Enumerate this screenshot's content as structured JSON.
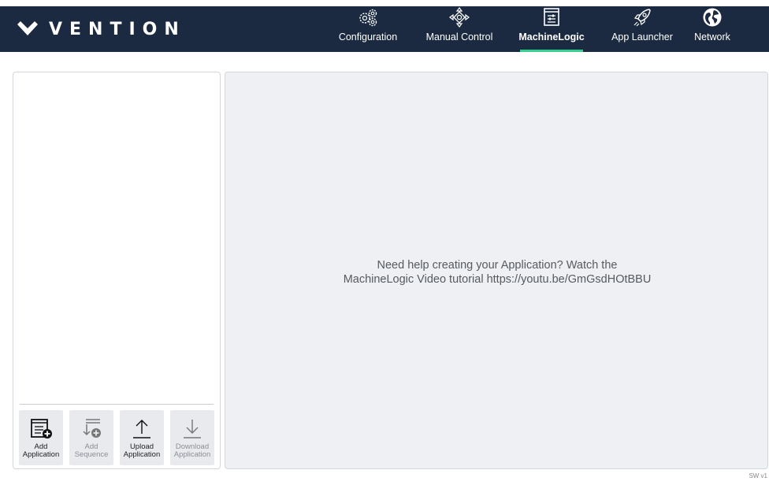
{
  "brand": {
    "name": "VENTION"
  },
  "nav": {
    "items": [
      {
        "label": "Configuration",
        "icon": "gears-icon"
      },
      {
        "label": "Manual Control",
        "icon": "joystick-icon"
      },
      {
        "label": "MachineLogic",
        "icon": "logic-icon",
        "active": true
      },
      {
        "label": "App Launcher",
        "icon": "rocket-icon"
      },
      {
        "label": "Network",
        "icon": "globe-icon"
      }
    ],
    "active_color": "#33d08f"
  },
  "toolbar": {
    "add_application": "Add Application",
    "add_sequence": "Add Sequence",
    "upload_application": "Upload Application",
    "download_application": "Download Application"
  },
  "main": {
    "help_line1": "Need help creating your Application? Watch the",
    "help_line2": "MachineLogic Video tutorial https://youtu.be/GmGsdHOtBBU"
  },
  "footer": {
    "version": "SW v1"
  },
  "colors": {
    "header_bg": "#1b2a40",
    "panel_bg": "#eff0f3",
    "accent": "#33d08f"
  }
}
